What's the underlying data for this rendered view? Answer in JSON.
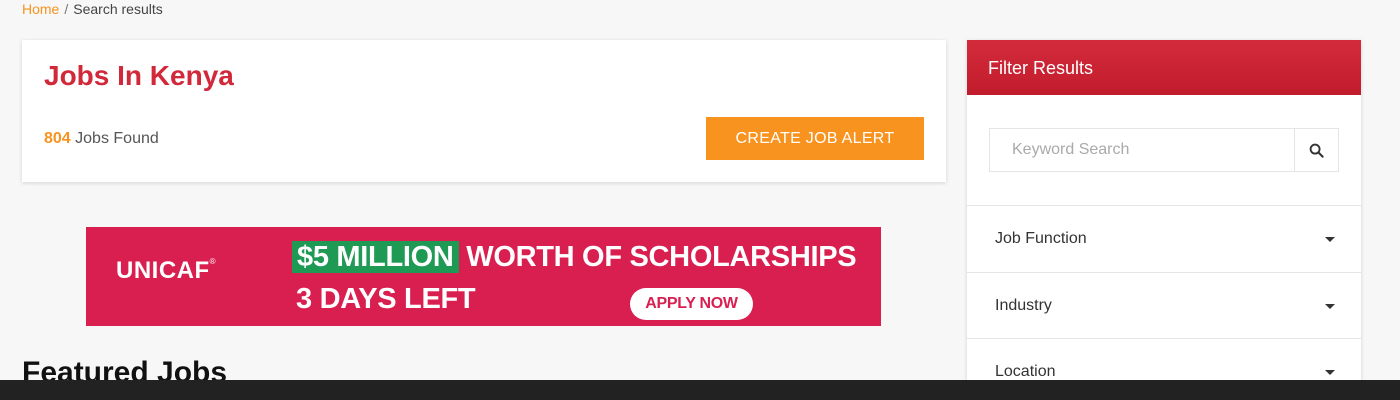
{
  "breadcrumb": {
    "home": "Home",
    "separator": "/",
    "current": "Search results"
  },
  "results": {
    "title": "Jobs In Kenya",
    "count": "804",
    "count_suffix": " Jobs Found",
    "alert_button": "CREATE JOB ALERT"
  },
  "banner": {
    "logo": "UNICAF",
    "logo_mark": "®",
    "highlight": "$5 MILLION",
    "line1_rest": " WORTH OF SCHOLARSHIPS",
    "line2": "3 DAYS LEFT",
    "cta": "APPLY NOW"
  },
  "featured": {
    "heading": "Featured Jobs"
  },
  "filter": {
    "header": "Filter Results",
    "search_placeholder": "Keyword Search",
    "search_value": "",
    "sections": [
      "Job Function",
      "Industry",
      "Location"
    ]
  },
  "icons": {
    "search": "search-icon",
    "dropdown": "caret-down-icon"
  },
  "colors": {
    "accent_orange": "#f7931e",
    "brand_red": "#d1283a",
    "banner_pink": "#d81f4f",
    "banner_green": "#1f9a54"
  }
}
